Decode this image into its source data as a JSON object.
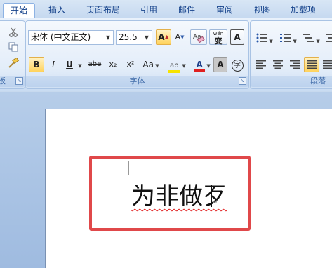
{
  "tabs": [
    {
      "label": "开始",
      "active": true
    },
    {
      "label": "插入"
    },
    {
      "label": "页面布局"
    },
    {
      "label": "引用"
    },
    {
      "label": "邮件"
    },
    {
      "label": "审阅"
    },
    {
      "label": "视图"
    },
    {
      "label": "加载项"
    }
  ],
  "clipboard": {
    "label": "板",
    "icons": [
      "cut-icon",
      "copy-icon",
      "format-painter-icon"
    ]
  },
  "font": {
    "group_label": "字体",
    "font_name": "宋体 (中文正文)",
    "font_size": "25.5",
    "grow_glyph": "A",
    "shrink_glyph": "A",
    "change_case_glyph": "Aa",
    "phonetic_top": "wén",
    "phonetic_char": "变",
    "char_border_glyph": "A",
    "bold": "B",
    "italic": "I",
    "underline": "U",
    "strike": "abe",
    "subscript": "x₂",
    "superscript": "x²",
    "case_label": "Aa",
    "highlight_glyph": "ab",
    "font_color_glyph": "A",
    "shading_glyph": "A",
    "enclose_glyph": "字",
    "bold_active": true,
    "colors": {
      "highlight": "#f7e300",
      "font_color": "#e02020"
    }
  },
  "paragraph": {
    "group_label": "段落",
    "icons": [
      "bullets-icon",
      "numbering-icon",
      "multilevel-list-icon",
      "align-left-icon",
      "align-center-icon",
      "align-right-icon",
      "justify-icon"
    ]
  },
  "document": {
    "text": "为非做歹",
    "annotation_color": "#e0484a"
  }
}
